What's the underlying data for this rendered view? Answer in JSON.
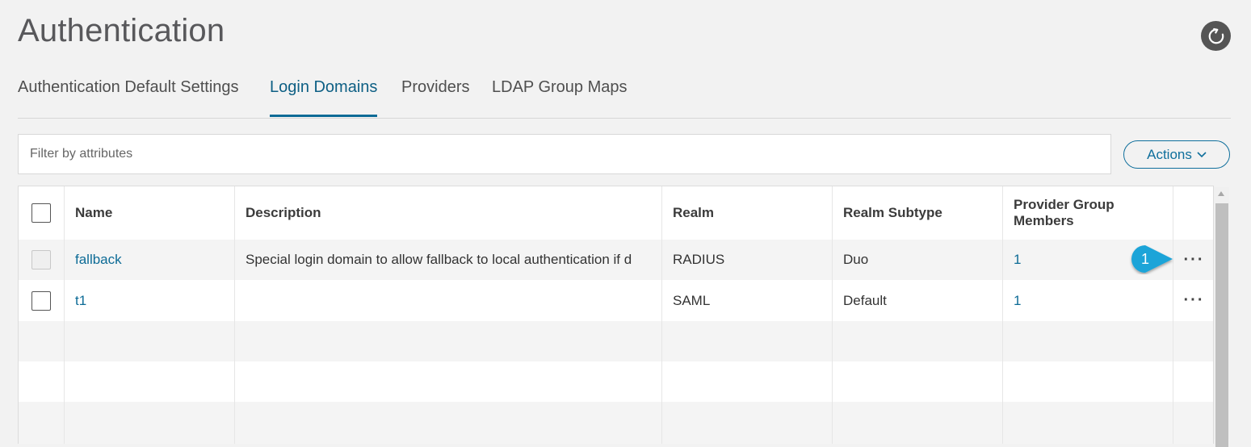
{
  "header": {
    "title": "Authentication"
  },
  "tabs": [
    {
      "label": "Authentication Default Settings"
    },
    {
      "label": "Login Domains"
    },
    {
      "label": "Providers"
    },
    {
      "label": "LDAP Group Maps"
    }
  ],
  "filter": {
    "placeholder": "Filter by attributes"
  },
  "actions": {
    "label": "Actions"
  },
  "table": {
    "columns": [
      "Name",
      "Description",
      "Realm",
      "Realm Subtype",
      "Provider Group Members"
    ],
    "rows": [
      {
        "name": "fallback",
        "description": "Special login domain to allow fallback to local authentication if d",
        "realm": "RADIUS",
        "subtype": "Duo",
        "members": "1",
        "more": "···"
      },
      {
        "name": "t1",
        "description": "",
        "realm": "SAML",
        "subtype": "Default",
        "members": "1",
        "more": "···"
      }
    ]
  },
  "callout": {
    "number": "1"
  },
  "colors": {
    "accent": "#0d6b96",
    "callout": "#1ca4d8",
    "background": "#f2f2f2"
  }
}
